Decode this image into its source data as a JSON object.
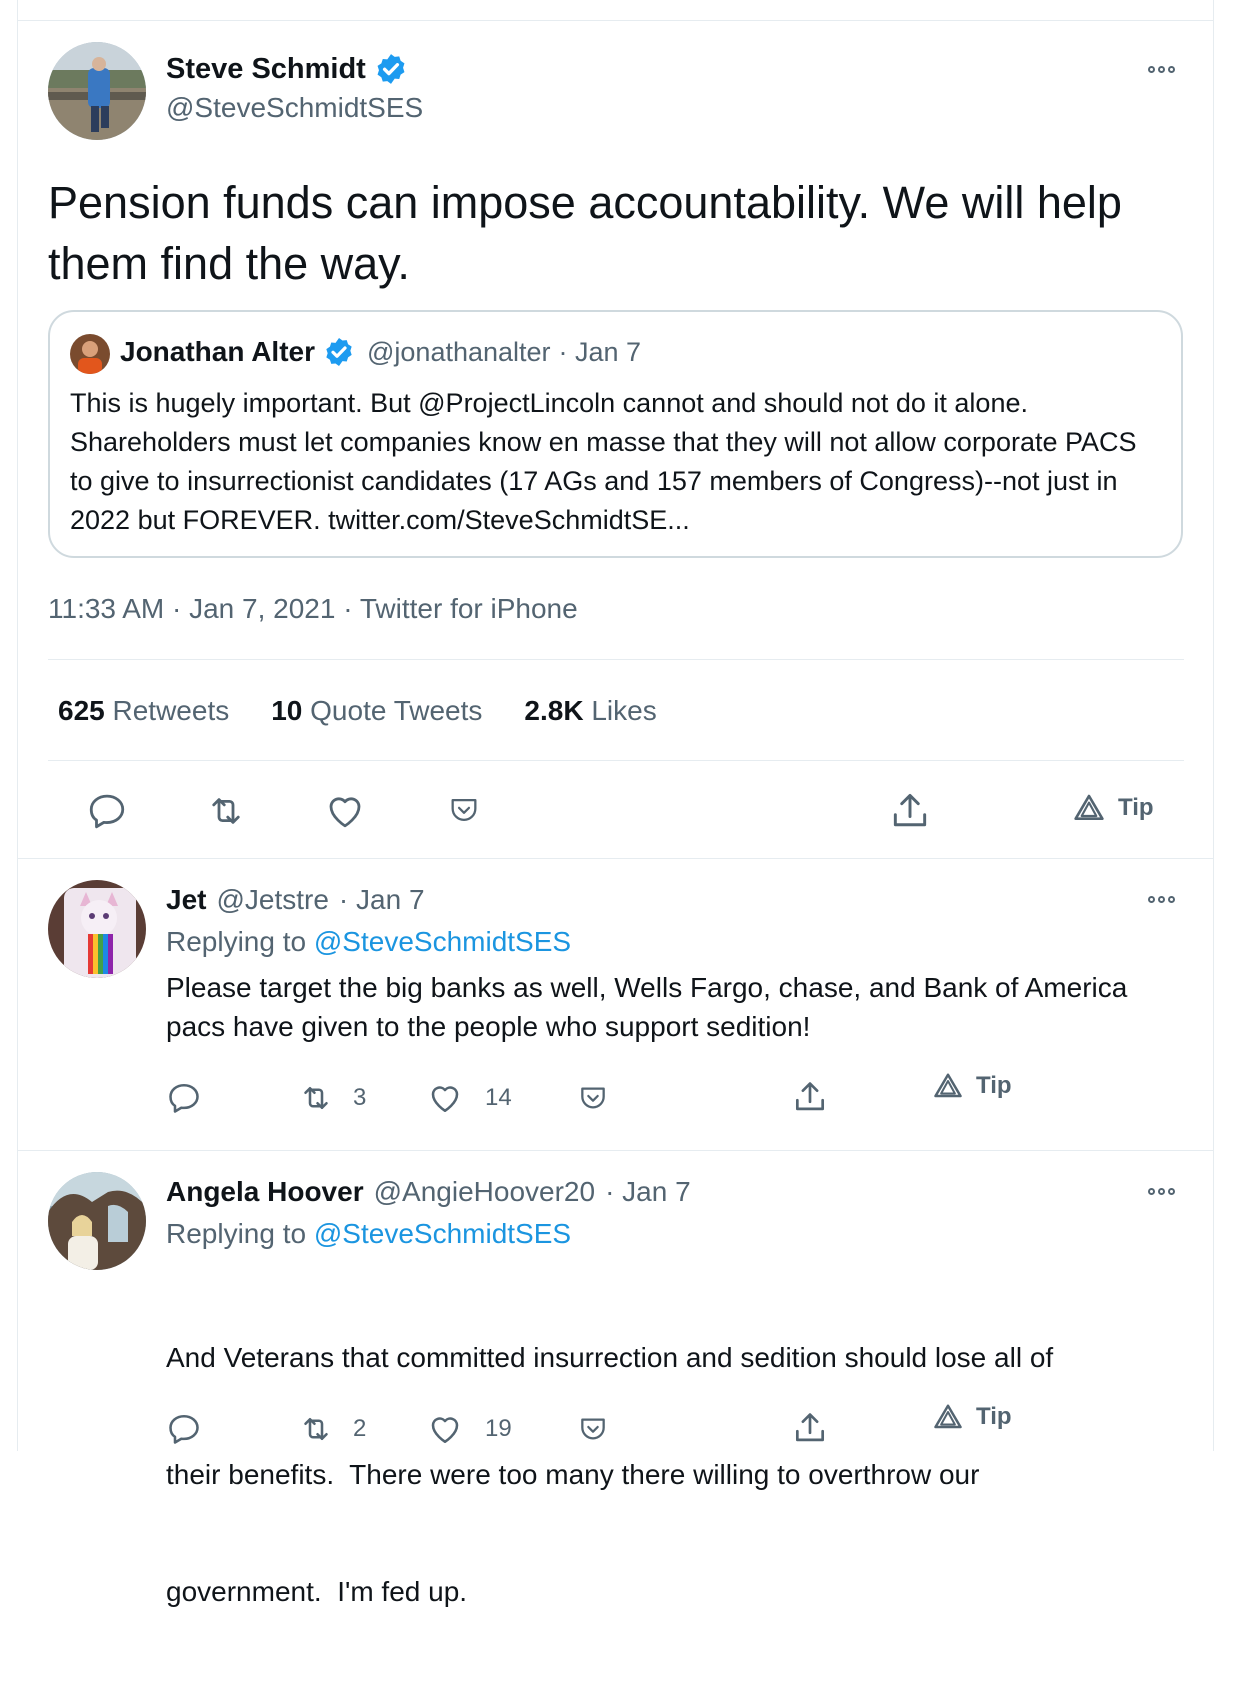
{
  "main_tweet": {
    "author_name": "Steve Schmidt",
    "author_handle": "@SteveSchmidtSES",
    "text": "Pension funds can impose accountability. We will help them find the way.",
    "quoted": {
      "author_name": "Jonathan Alter",
      "author_handle": "@jonathanalter",
      "date": "· Jan 7",
      "text": "This is hugely important. But @ProjectLincoln cannot and should not do it alone. Shareholders must let companies know en masse that they will not allow corporate PACS to give to insurrectionist candidates (17 AGs and 157 members of Congress)--not just in 2022 but FOREVER. twitter.com/SteveSchmidtSE..."
    },
    "timestamp": "11:33 AM · Jan 7, 2021 · Twitter for iPhone",
    "stats": {
      "retweets_count": "625",
      "retweets_label": "Retweets",
      "quotes_count": "10",
      "quotes_label": "Quote Tweets",
      "likes_count": "2.8K",
      "likes_label": "Likes"
    },
    "tip_label": "Tip"
  },
  "replies": [
    {
      "author_name": "Jet",
      "author_handle": "@Jetstre",
      "date": "· Jan 7",
      "replying_prefix": "Replying to",
      "replying_to": "@SteveSchmidtSES",
      "text_line1": "Please target the big banks as well, Wells Fargo, chase, and Bank of America",
      "text_line2": "pacs have given to the people who support sedition!",
      "retweets": "3",
      "likes": "14",
      "tip_label": "Tip"
    },
    {
      "author_name": "Angela Hoover",
      "author_handle": "@AngieHoover20",
      "date": "· Jan 7",
      "replying_prefix": "Replying to",
      "replying_to": "@SteveSchmidtSES",
      "text_line1": "And Veterans that committed insurrection and sedition should lose all of",
      "text_line2": "their benefits.  There were too many there willing to overthrow our",
      "text_line3": "government.  I'm fed up.",
      "retweets": "2",
      "likes": "19",
      "tip_label": "Tip"
    }
  ],
  "icons": {
    "verified": "verified-badge-icon",
    "more": "more-options-icon",
    "reply": "reply-icon",
    "retweet": "retweet-icon",
    "like": "heart-icon",
    "save": "save-pocket-icon",
    "share": "share-icon",
    "tip": "tip-icon"
  },
  "colors": {
    "accent": "#1b95e0",
    "verified": "#1d9bf0",
    "muted": "#536471",
    "divider": "#e6ecf0"
  }
}
